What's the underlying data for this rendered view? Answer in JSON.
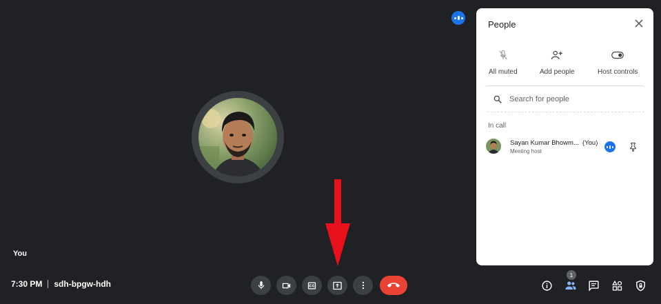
{
  "stage": {
    "self_label": "You"
  },
  "meeting": {
    "time": "7:30 PM",
    "code": "sdh-bpgw-hdh"
  },
  "controls": {
    "microphone": "mic-icon",
    "camera": "camera-icon",
    "captions": "captions-icon",
    "present": "present-screen-icon",
    "more": "more-options-icon",
    "end_call": "end-call-icon",
    "end_call_color": "#ea4335"
  },
  "right_toolbar": {
    "people_count": "1",
    "icons": [
      "info-icon",
      "people-icon",
      "chat-icon",
      "activities-icon",
      "host-controls-icon"
    ]
  },
  "people_panel": {
    "title": "People",
    "quick_actions": {
      "all_muted": "All muted",
      "add_people": "Add people",
      "host_controls": "Host controls"
    },
    "search_placeholder": "Search for people",
    "section": "In call",
    "participants": [
      {
        "name": "Sayan Kumar Bhowm...",
        "you": "(You)",
        "role": "Meeting host"
      }
    ]
  },
  "colors": {
    "background": "#202124",
    "accent": "#1a73e8",
    "annotation_arrow": "#e8111b"
  }
}
